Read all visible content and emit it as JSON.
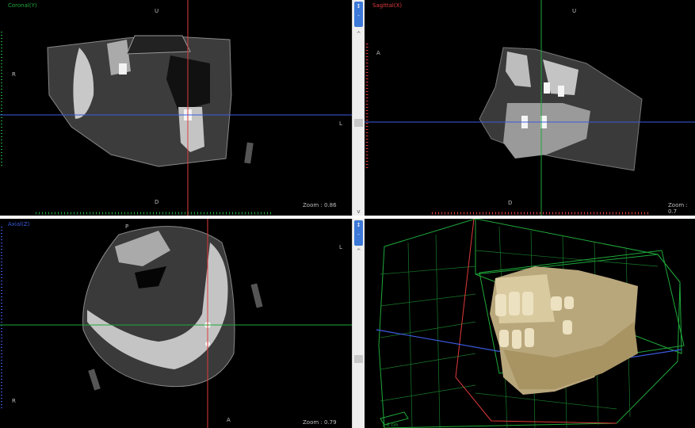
{
  "views": {
    "coronal": {
      "title": "Coronal(Y)",
      "title_color": "#1fa83a",
      "orient_top": "U",
      "orient_bottom": "D",
      "orient_left": "R",
      "orient_right": "L",
      "zoom": "Zoom : 0.86"
    },
    "sagittal": {
      "title": "Sagittal(X)",
      "title_color": "#e03b3b",
      "orient_top": "U",
      "orient_bottom": "D",
      "orient_left": "A",
      "zoom": "Zoom : 0.7"
    },
    "axial": {
      "title": "Axial(Z)",
      "title_color": "#3b5be0",
      "orient_top": "P",
      "orient_bottom": "A",
      "orient_left": "R",
      "orient_right": "L",
      "zoom": "Zoom : 0.79"
    },
    "volume": {
      "scale_label": "1.6 cm"
    }
  },
  "scrollbars": {
    "top_button": "↕",
    "up_arrow": "^",
    "down_arrow": "v",
    "collapse": "-"
  },
  "colors": {
    "coronal_axis": "#1fa83a",
    "sagittal_axis": "#e03b3b",
    "axial_axis": "#3b5be0",
    "bone": "#b8b8b8",
    "teeth_3d": "#d9caa0"
  }
}
